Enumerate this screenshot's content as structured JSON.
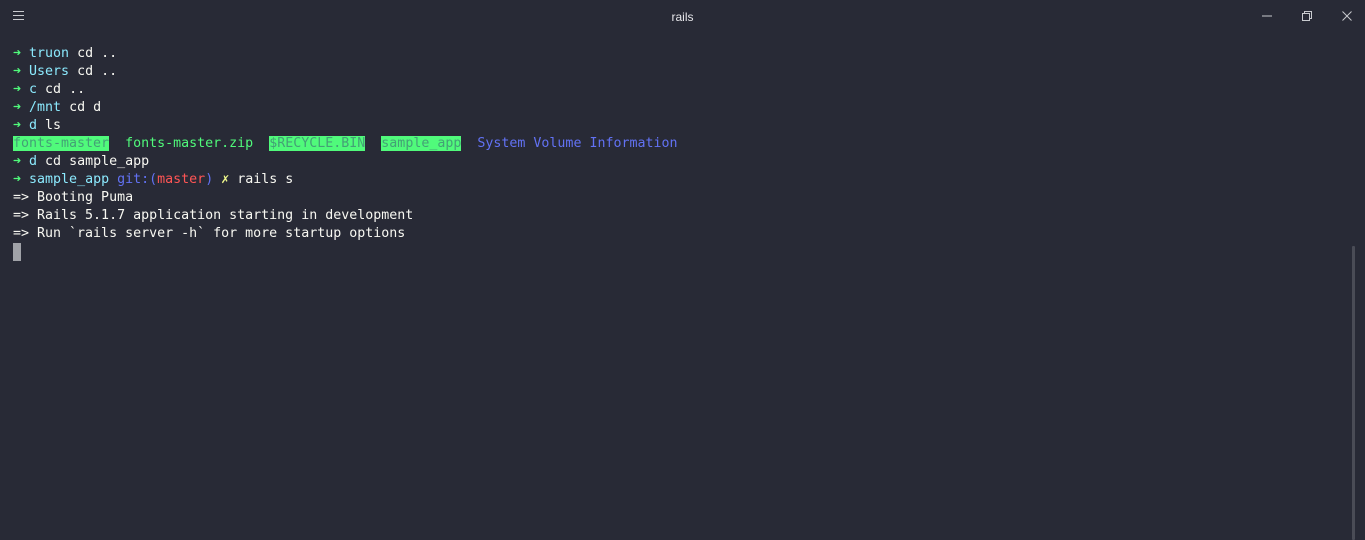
{
  "window": {
    "title": "rails",
    "menu_icon": "hamburger-menu-icon",
    "controls": [
      "minimize-icon",
      "restore-icon",
      "close-icon"
    ]
  },
  "terminal": {
    "arrow": "➜",
    "lines": [
      {
        "dir": "truon",
        "cmd": " cd .."
      },
      {
        "dir": "Users",
        "cmd": " cd .."
      },
      {
        "dir": "c",
        "cmd": " cd .."
      },
      {
        "dir": "/mnt",
        "cmd": " cd d"
      },
      {
        "dir": "d",
        "cmd": " ls"
      }
    ],
    "ls_output": {
      "items": [
        "fonts-master",
        "fonts-master.zip",
        "$RECYCLE.BIN",
        "sample_app",
        "System Volume Information"
      ]
    },
    "line_cd_sample": {
      "dir": "d",
      "cmd": " cd sample_app"
    },
    "line_rails": {
      "dir": "sample_app",
      "git_label": "git:(",
      "branch": "master",
      "git_close": ")",
      "dirty": "✗",
      "cmd": " rails s"
    },
    "output": [
      "=> Booting Puma",
      "=> Rails 5.1.7 application starting in development",
      "=> Run `rails server -h` for more startup options"
    ]
  },
  "colors": {
    "background": "#282a36",
    "arrow": "#50fa7b",
    "directory": "#8be9fd",
    "git": "#6272f4",
    "branch": "#ff5555",
    "dirty": "#f1fa8c"
  }
}
